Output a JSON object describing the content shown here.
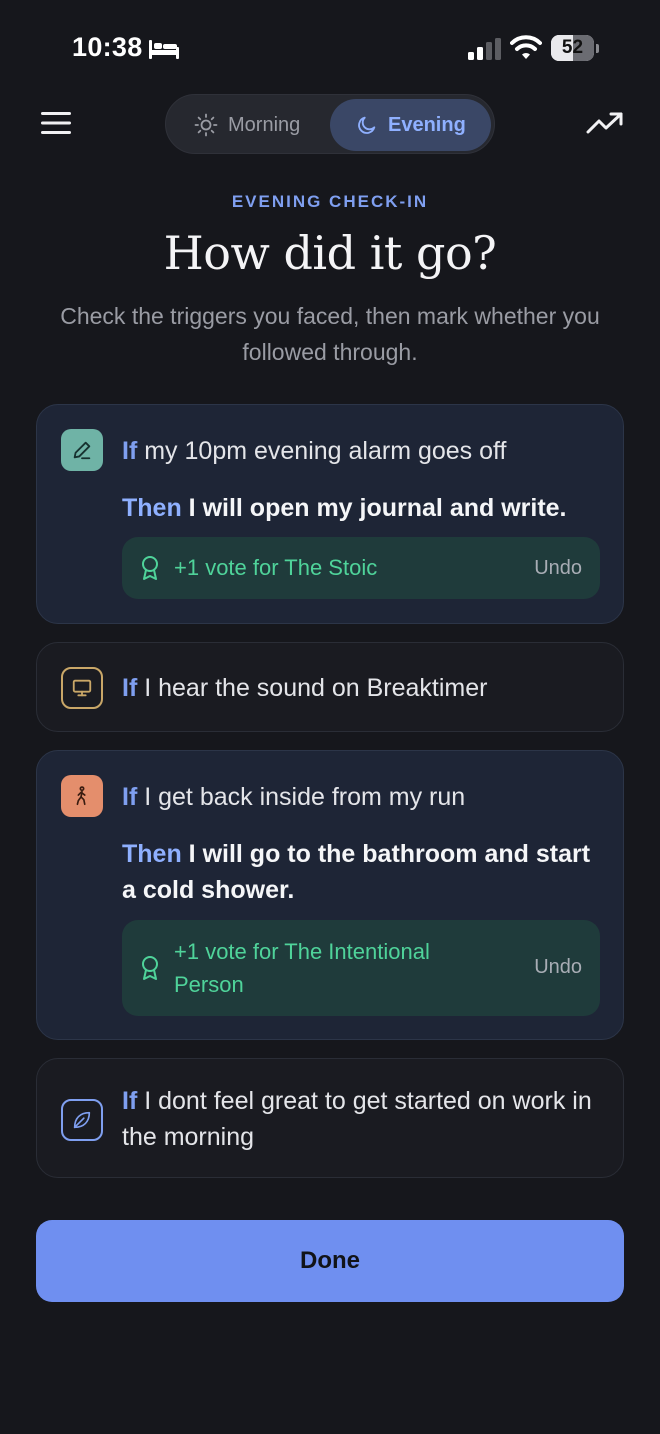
{
  "status": {
    "time": "10:38",
    "battery": "52",
    "battery_level": 0.52
  },
  "tabs": {
    "morning": "Morning",
    "evening": "Evening",
    "selected": "evening"
  },
  "heading": {
    "eyebrow": "EVENING CHECK-IN",
    "title": "How did it go?",
    "subtitle": "Check the triggers you faced, then mark whether you followed through."
  },
  "keywords": {
    "if": "If",
    "then": "Then"
  },
  "cards": [
    {
      "icon": "pencil-icon",
      "icon_color": "#6fb3a6",
      "if_text": "my 10pm evening alarm goes off",
      "then_text": "I will open my journal and write.",
      "vote_text": "+1 vote for The Stoic",
      "undo": "Undo"
    },
    {
      "icon": "monitor-icon",
      "icon_color": "#c9a768",
      "if_text": "I hear the sound on Breaktimer"
    },
    {
      "icon": "walking-person-icon",
      "icon_color": "#e48e6c",
      "if_text": "I get back inside from my run",
      "then_text": "I will go to the bathroom and start a cold shower.",
      "vote_text": "+1 vote for The Intentional Person",
      "undo": "Undo"
    },
    {
      "icon": "leaf-icon",
      "icon_color": "#7f9ff0",
      "if_text": "I dont feel great to get started on work in the morning"
    }
  ],
  "done_label": "Done",
  "colors": {
    "background": "#16171c",
    "accent": "#6f8ff0",
    "vote_green": "#4fd39a",
    "vote_bg": "#1f3b3b"
  }
}
